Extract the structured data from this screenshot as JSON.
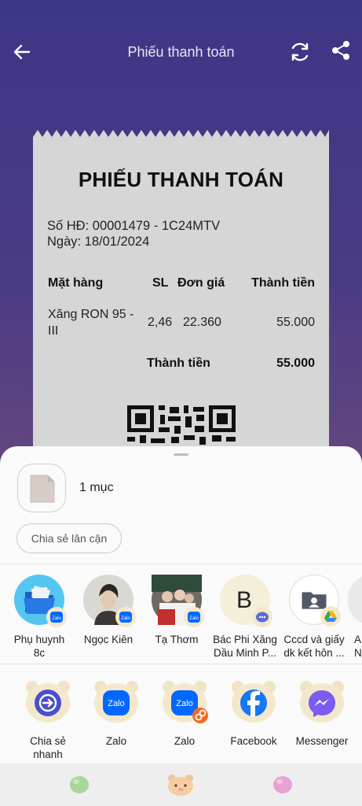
{
  "appbar": {
    "title": "Phiếu thanh toán"
  },
  "receipt": {
    "title": "PHIẾU THANH TOÁN",
    "invoice_no": "Số HĐ: 00001479 - 1C24MTV",
    "date": "Ngày: 18/01/2024",
    "headers": {
      "item": "Mặt hàng",
      "qty": "SL",
      "price": "Đơn giá",
      "amount": "Thành tiền"
    },
    "rows": [
      {
        "item_line1": "Xăng RON 95 -",
        "item_line2": "III",
        "qty": "2,46",
        "price": "22.360",
        "amount": "55.000"
      }
    ],
    "total_label": "Thành tiền",
    "total_value": "55.000"
  },
  "share_sheet": {
    "count": "1 mục",
    "nearby_label": "Chia sẻ lân cận",
    "contacts": [
      {
        "line1": "Phụ huynh",
        "line2": "8c",
        "icon": "folder-avatar",
        "badge": "zalo"
      },
      {
        "line1": "Ngọc Kiên",
        "line2": "",
        "icon": "person-photo-avatar",
        "badge": "zalo"
      },
      {
        "line1": "Tạ Thơm",
        "line2": "",
        "icon": "group-photo-avatar",
        "badge": "zalo"
      },
      {
        "line1": "Bác Phi Xăng",
        "line2": "Dầu Minh P...",
        "icon": "letter-avatar",
        "letter": "B",
        "badge": "messages"
      },
      {
        "line1": "Cccd và giấy",
        "line2": "dk kết hôn ...",
        "icon": "folder-avatar",
        "badge": "google-drive"
      },
      {
        "line1": "A",
        "line2": "Nu",
        "icon": "partial-avatar",
        "badge": ""
      }
    ],
    "apps": [
      {
        "line1": "Chia sẻ",
        "line2": "nhanh",
        "icon": "quick-share-icon"
      },
      {
        "line1": "Zalo",
        "line2": "",
        "icon": "zalo-icon"
      },
      {
        "line1": "Zalo",
        "line2": "",
        "icon": "zalo-dual-icon"
      },
      {
        "line1": "Facebook",
        "line2": "",
        "icon": "facebook-icon"
      },
      {
        "line1": "Messenger",
        "line2": "",
        "icon": "messenger-icon"
      }
    ],
    "zalo_text": "Zalo"
  },
  "colors": {
    "background_top": "#3d3686",
    "background_bottom": "#7a567a",
    "zalo_blue": "#0068ff",
    "facebook_blue": "#1877f2",
    "sticker_cream": "#f4e8cc"
  }
}
